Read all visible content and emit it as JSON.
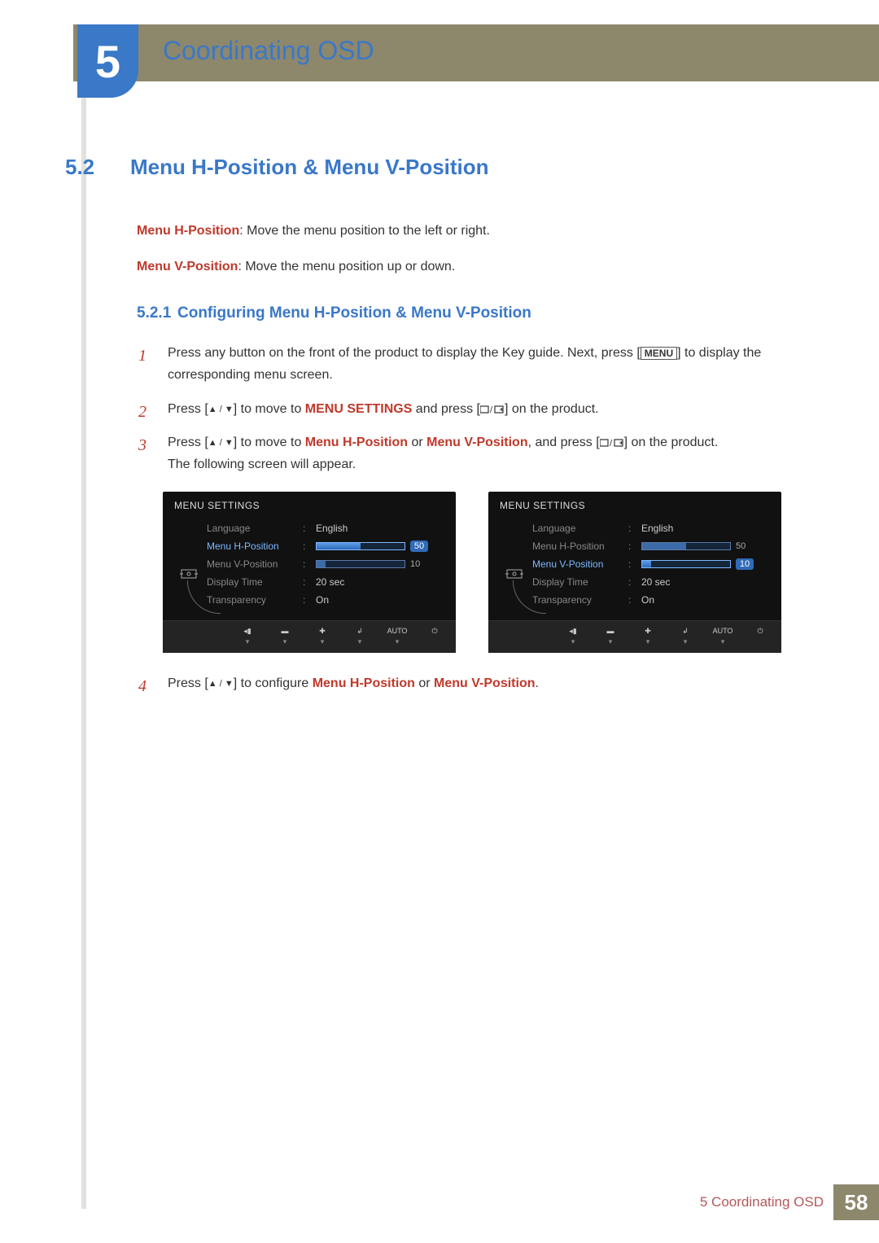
{
  "chapter": {
    "number": "5",
    "title": "Coordinating OSD"
  },
  "section": {
    "number": "5.2",
    "title": "Menu H-Position & Menu V-Position"
  },
  "desc_h": {
    "label": "Menu H-Position",
    "text": ": Move the menu position to the left or right."
  },
  "desc_v": {
    "label": "Menu V-Position",
    "text": ": Move the menu position up or down."
  },
  "subsection": {
    "number": "5.2.1",
    "title": "Configuring Menu H-Position & Menu V-Position"
  },
  "steps": {
    "s1": {
      "pre": "Press any button on the front of the product to display the Key guide. Next, press [",
      "key": "MENU",
      "post": "] to display the corresponding menu screen."
    },
    "s2": {
      "pre": "Press [",
      "mid": "] to move to ",
      "target": "MENU SETTINGS",
      "mid2": " and press [",
      "post": "] on the product."
    },
    "s3": {
      "pre": "Press [",
      "mid": "] to move to ",
      "t1": "Menu H-Position",
      "or": " or ",
      "t2": "Menu V-Position",
      "mid2": ", and press [",
      "post": "] on the product.",
      "line2": "The following screen will appear."
    },
    "s4": {
      "pre": "Press [",
      "mid": "] to configure ",
      "t1": "Menu H-Position",
      "or": " or ",
      "t2": "Menu V-Position",
      "post": "."
    }
  },
  "osd": {
    "header": "MENU SETTINGS",
    "rows": {
      "language": {
        "label": "Language",
        "value": "English"
      },
      "h": {
        "label": "Menu H-Position",
        "num": "50",
        "fillPct": 50
      },
      "v": {
        "label": "Menu V-Position",
        "num": "10",
        "fillPct": 10
      },
      "display": {
        "label": "Display Time",
        "value": "20 sec"
      },
      "trans": {
        "label": "Transparency",
        "value": "On"
      }
    },
    "footer": {
      "auto": "AUTO"
    }
  },
  "footer": {
    "chapter_label": "5 Coordinating OSD",
    "page": "58"
  }
}
